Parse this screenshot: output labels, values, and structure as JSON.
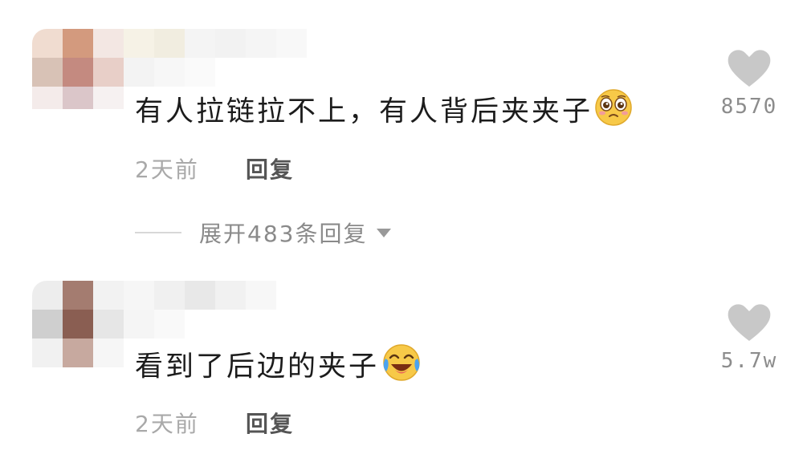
{
  "comments": [
    {
      "text": "有人拉链拉不上，有人背后夹夹子",
      "emoji": "pleading-face-icon",
      "time": "2天前",
      "reply_label": "回复",
      "like_count": "8570",
      "expand_label": "展开483条回复"
    },
    {
      "text": "看到了后边的夹子",
      "emoji": "laughing-tears-face-icon",
      "time": "2天前",
      "reply_label": "回复",
      "like_count": "5.7w"
    }
  ],
  "colors": {
    "like_heart": "#c8c8c8",
    "meta_text": "#a9a9a9",
    "emoji_yellow": "#f7c948"
  }
}
